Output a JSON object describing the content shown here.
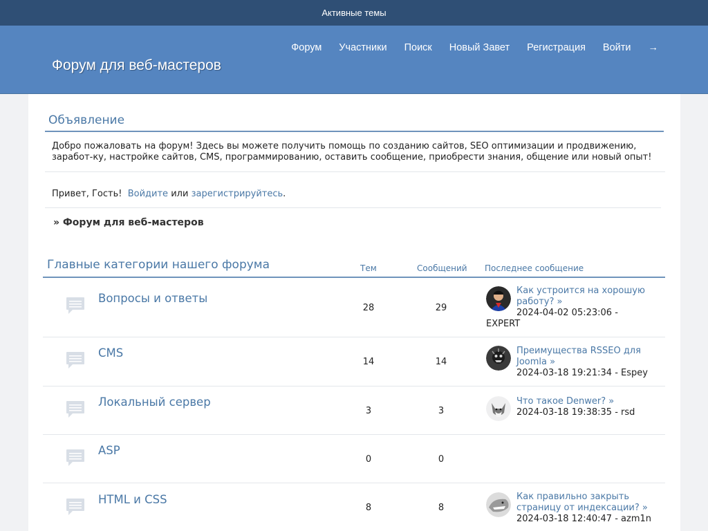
{
  "topbar": {
    "active_topics": "Активные темы"
  },
  "header": {
    "site_title": "Форум для веб-мастеров",
    "nav": [
      "Форум",
      "Участники",
      "Поиск",
      "Новый Завет",
      "Регистрация",
      "Войти",
      "→"
    ]
  },
  "announcement": {
    "title": "Объявление",
    "text": "Добро пожаловать на форум! Здесь вы можете получить помощь по созданию сайтов, SEO оптимизации и продвижению, заработ-ку, настройке сайтов, CMS, программированию, оставить сообщение, приобрести знания, общение или новый опыт!"
  },
  "greeting": {
    "prefix": "Привет, Гость!",
    "login": "Войдите",
    "or": "или",
    "register": "зарегистрируйтесь",
    "suffix": "."
  },
  "breadcrumb": "» Форум для веб-мастеров",
  "categories": {
    "title": "Главные категории нашего форума",
    "col_topics": "Тем",
    "col_posts": "Сообщений",
    "col_last": "Последнее сообщение",
    "rows": [
      {
        "name": "Вопросы и ответы",
        "topics": "28",
        "posts": "29",
        "last_title": "Как устроится на хорошую работу? »",
        "last_date": "2024-04-02 05:23:06 -",
        "last_author": "EXPERT"
      },
      {
        "name": "CMS",
        "topics": "14",
        "posts": "14",
        "last_title": "Преимущества RSSEO для Joomla »",
        "last_date": "2024-03-18 19:21:34 - Espey",
        "last_author": ""
      },
      {
        "name": "Локальный сервер",
        "topics": "3",
        "posts": "3",
        "last_title": "Что такое Denwer? »",
        "last_date": "2024-03-18 19:38:35 - rsd",
        "last_author": ""
      },
      {
        "name": "ASP",
        "topics": "0",
        "posts": "0",
        "last_title": "",
        "last_date": "",
        "last_author": ""
      },
      {
        "name": "HTML и CSS",
        "topics": "8",
        "posts": "8",
        "last_title": "Как правильно закрыть страницу от индексации? »",
        "last_date": "2024-03-18 12:40:47 - azm1n",
        "last_author": ""
      }
    ]
  },
  "colors": {
    "topbar": "#2f4f75",
    "header": "#5585c0",
    "link": "#4a78a6"
  }
}
